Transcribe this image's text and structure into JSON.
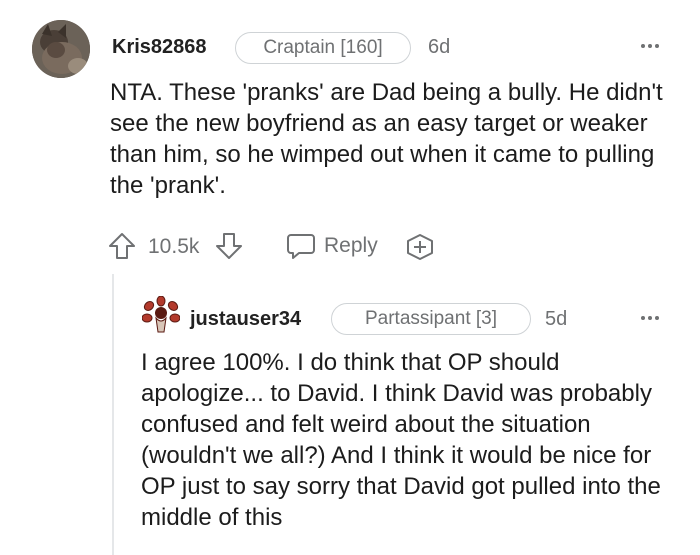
{
  "comment": {
    "username": "Kris82868",
    "flair": "Craptain [160]",
    "age": "6d",
    "text": "NTA. These 'pranks' are Dad being a bully. He didn't see the new boyfriend as an easy target or weaker than him, so he wimped out when it came to pulling the 'prank'.",
    "votes": "10.5k",
    "reply_label": "Reply",
    "avatar_icon": "cat-avatar",
    "upvote_icon": "arrow-up-outline",
    "downvote_icon": "arrow-down-outline",
    "reply_icon": "speech-bubble-outline",
    "award_icon": "plus-circle-outline"
  },
  "reply": {
    "username": "justauser34",
    "flair": "Partassipant [3]",
    "age": "5d",
    "text": "I agree 100%. I do think that OP should apologize... to David. I think David was probably confused and felt weird about the situation (wouldn't we all?) And I think it would be nice for OP just to say sorry that David got pulled into the middle of this",
    "avatar_icon": "demogorgon-avatar"
  },
  "colors": {
    "text": "#1c1c1c",
    "muted": "#6f7173",
    "flair_border": "#cfd3d6",
    "thread_line": "#e5e7e9",
    "avatar_red": "#b33a2c"
  }
}
